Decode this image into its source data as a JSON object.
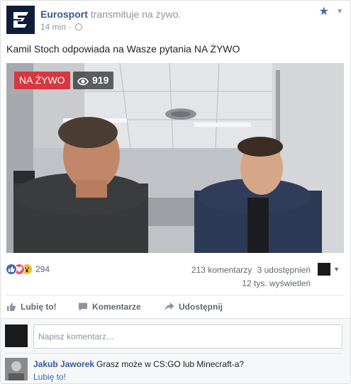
{
  "post": {
    "page_name": "Eurosport",
    "action_text": "transmituje na żywo.",
    "time": "14 min",
    "separator": "·",
    "text": "Kamil Stoch odpowiada na Wasze pytania NA ŻYWO"
  },
  "video": {
    "live_label": "NA ŻYWO",
    "viewer_count": "919"
  },
  "stats": {
    "reaction_count": "294",
    "comments": "213 komentarzy",
    "shares": "3 udostępnień",
    "views": "12 tys. wyświetleń"
  },
  "actions": {
    "like": "Lubię to!",
    "comment": "Komentarze",
    "share": "Udostępnij"
  },
  "composer": {
    "placeholder": "Napisz komentarz..."
  },
  "comment": {
    "author": "Jakub Jaworek",
    "text": "Grasz może w CS:GO lub Minecraft-a?",
    "like_label": "Lubię to!"
  },
  "icons": {
    "favorite": "star-icon",
    "menu": "chevron-down-icon",
    "audience": "globe-icon",
    "viewers": "eye-icon",
    "reactions": [
      "like-icon",
      "love-icon",
      "wow-icon"
    ]
  },
  "colors": {
    "link": "#365899",
    "live_badge": "#d7373f",
    "accent": "#4267b2"
  }
}
